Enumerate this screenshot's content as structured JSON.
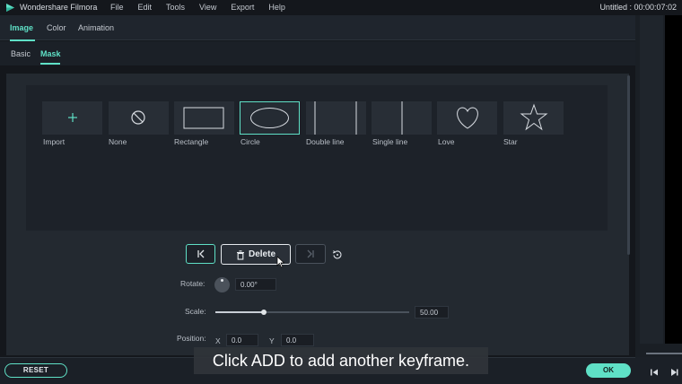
{
  "app": {
    "name": "Wondershare Filmora",
    "menu": [
      "File",
      "Edit",
      "Tools",
      "View",
      "Export",
      "Help"
    ],
    "project_title": "Untitled : 00:00:07:02"
  },
  "tabs": [
    "Image",
    "Color",
    "Animation"
  ],
  "subtabs": [
    "Basic",
    "Mask"
  ],
  "masks": [
    {
      "label": "Import",
      "icon": "plus-icon"
    },
    {
      "label": "None",
      "icon": "no-symbol-icon"
    },
    {
      "label": "Rectangle",
      "icon": "rectangle-icon"
    },
    {
      "label": "Circle",
      "icon": "circle-icon"
    },
    {
      "label": "Double line",
      "icon": "double-line-icon"
    },
    {
      "label": "Single line",
      "icon": "single-line-icon"
    },
    {
      "label": "Love",
      "icon": "heart-icon"
    },
    {
      "label": "Star",
      "icon": "star-icon"
    }
  ],
  "selected_mask": "Circle",
  "keyframe": {
    "delete_label": "Delete"
  },
  "properties": {
    "rotate_label": "Rotate:",
    "rotate_value": "0.00°",
    "scale_label": "Scale:",
    "scale_value": "50.00",
    "scale_fraction": 0.25,
    "position_label": "Position:",
    "x_label": "X",
    "x_value": "0.0",
    "y_label": "Y",
    "y_value": "0.0"
  },
  "footer": {
    "reset_label": "RESET",
    "ok_label": "OK"
  },
  "caption": "Click ADD to add another keyframe.",
  "colors": {
    "accent": "#5fe0c6",
    "background": "#14171c",
    "panel": "#232930"
  }
}
